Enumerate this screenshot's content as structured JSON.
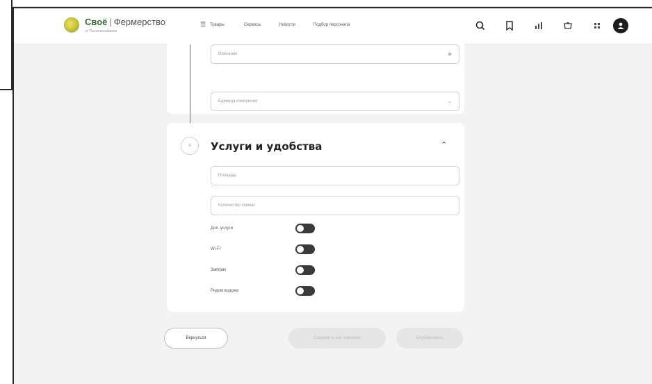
{
  "header": {
    "brand": "Своё",
    "separator": "|",
    "section": "Фермерство",
    "subtitle": "от Россельхозбанка",
    "menu_label": "Товары",
    "nav": [
      "Сервисы",
      "Новости",
      "Подбор персонала"
    ]
  },
  "icons": [
    "search-icon",
    "bookmark-icon",
    "chart-icon",
    "cart-icon",
    "grid-icon",
    "user-icon"
  ],
  "card1": {
    "fields": [
      {
        "placeholder": "Описание",
        "suffix": "⊗"
      },
      {
        "placeholder": "Единица измерения",
        "suffix": "⌄"
      }
    ]
  },
  "services": {
    "step_number": "4",
    "title": "Услуги и удобства",
    "fields": [
      {
        "placeholder": "Площадь"
      },
      {
        "placeholder": "Количество комнат"
      }
    ],
    "toggles": [
      {
        "label": "Доп. услуги",
        "on": false
      },
      {
        "label": "Wi-Fi",
        "on": false
      },
      {
        "label": "Завтрак",
        "on": false
      },
      {
        "label": "Рядом водоем",
        "on": false
      }
    ]
  },
  "actions": {
    "back": "Вернуться",
    "save_draft": "Сохранить как черновик",
    "publish": "Опубликовать"
  },
  "colors": {
    "accent": "#2f8a5e",
    "toggle": "#3a3a3a"
  }
}
